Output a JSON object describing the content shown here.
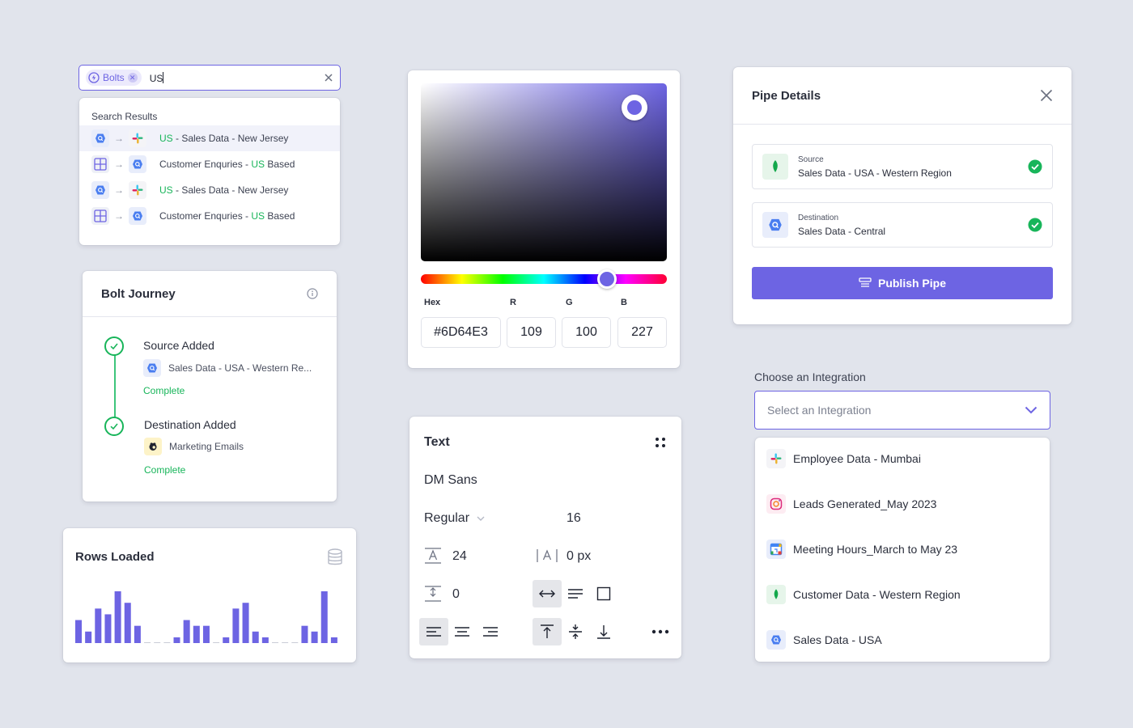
{
  "colors": {
    "accent": "#6D64E3",
    "success": "#18B55A",
    "background": "#E1E4EC"
  },
  "search": {
    "chip_label": "Bolts",
    "query": "US",
    "results_header": "Search Results",
    "results": [
      {
        "from_icon": "bigquery-icon",
        "to_icon": "slack-icon",
        "prefix": "",
        "highlight": "US",
        "suffix": " - Sales Data - New Jersey",
        "active": true
      },
      {
        "from_icon": "grid-icon",
        "to_icon": "bigquery-icon",
        "prefix": "Customer Enquries - ",
        "highlight": "US",
        "suffix": " Based",
        "active": false
      },
      {
        "from_icon": "bigquery-icon",
        "to_icon": "slack-icon",
        "prefix": "",
        "highlight": "US",
        "suffix": " - Sales Data - New Jersey",
        "active": false
      },
      {
        "from_icon": "grid-icon",
        "to_icon": "bigquery-icon",
        "prefix": "Customer Enquries - ",
        "highlight": "US",
        "suffix": " Based",
        "active": false
      }
    ]
  },
  "journey": {
    "title": "Bolt Journey",
    "steps": [
      {
        "title": "Source Added",
        "item": "Sales Data - USA - Western Re...",
        "icon": "bigquery-icon",
        "status": "Complete"
      },
      {
        "title": "Destination Added",
        "item": "Marketing Emails",
        "icon": "mailchimp-icon",
        "status": "Complete"
      }
    ]
  },
  "rows_loaded": {
    "title": "Rows Loaded"
  },
  "chart_data": {
    "type": "bar",
    "title": "Rows Loaded",
    "xlabel": "",
    "ylabel": "",
    "values": [
      4,
      2,
      6,
      5,
      9,
      7,
      3,
      0,
      0,
      0,
      1,
      4,
      3,
      3,
      0,
      1,
      6,
      7,
      2,
      1,
      0,
      0,
      0,
      3,
      2,
      9,
      1
    ]
  },
  "color_picker": {
    "hex_label": "Hex",
    "r_label": "R",
    "g_label": "G",
    "b_label": "B",
    "hex": "#6D64E3",
    "r": "109",
    "g": "100",
    "b": "227"
  },
  "text_panel": {
    "title": "Text",
    "font_family": "DM Sans",
    "font_weight": "Regular",
    "font_size": "16",
    "line_height": "24",
    "letter_spacing": "0 px",
    "paragraph_spacing": "0"
  },
  "pipe": {
    "title": "Pipe Details",
    "source_label": "Source",
    "source_value": "Sales Data - USA - Western Region",
    "destination_label": "Destination",
    "destination_value": "Sales Data - Central",
    "publish_label": "Publish Pipe"
  },
  "integration": {
    "label": "Choose an Integration",
    "placeholder": "Select an Integration",
    "options": [
      {
        "label": "Employee Data - Mumbai",
        "icon": "slack-icon"
      },
      {
        "label": "Leads Generated_May 2023",
        "icon": "instagram-icon"
      },
      {
        "label": "Meeting Hours_March to May 23",
        "icon": "google-calendar-icon"
      },
      {
        "label": "Customer Data - Western Region",
        "icon": "mongodb-icon"
      },
      {
        "label": "Sales Data - USA",
        "icon": "bigquery-icon"
      }
    ]
  }
}
